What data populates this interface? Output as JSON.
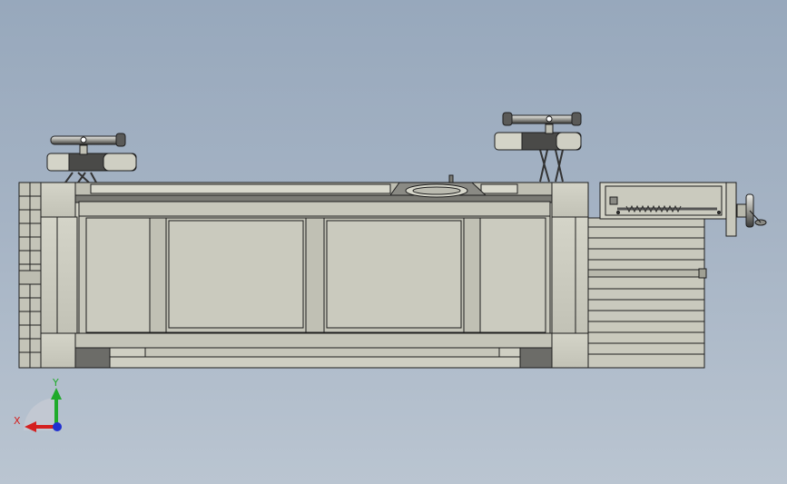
{
  "view": {
    "background_top": "#97a8bc",
    "background_bottom": "#bac5d1"
  },
  "triad": {
    "x_label": "X",
    "y_label": "Y",
    "x_color": "#d42020",
    "y_color": "#1faa2a",
    "z_color": "#2030d0"
  },
  "model": {
    "body_color": "#c9c9bd",
    "shade_color": "#a8a89c",
    "dark_color": "#6a6a66",
    "edge_color": "#1e1e1e",
    "handwheel_color": "#4a4a4a"
  }
}
